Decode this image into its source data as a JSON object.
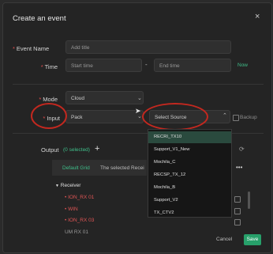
{
  "dialog": {
    "title": "Create an event",
    "close_glyph": "×"
  },
  "form": {
    "event_name": {
      "label": "Event Name",
      "required_mark": "*",
      "placeholder": "Add title"
    },
    "time": {
      "label": "Time",
      "required_mark": "*",
      "start_placeholder": "Start time",
      "separator": "-",
      "end_placeholder": "End time",
      "now_label": "Now"
    },
    "mode": {
      "label": "Mode",
      "required_mark": "*",
      "value": "Cloud"
    },
    "input": {
      "label": "Input",
      "required_mark": "*",
      "value": "Pack",
      "source_placeholder": "Select Source",
      "backup_label": "Backup"
    }
  },
  "source_options": [
    "RECRI_TX10",
    "Support_V1_New",
    "Mochila_C",
    "RECSP_TX_12",
    "Mochila_B",
    "Support_V2",
    "TX_CTV2"
  ],
  "output": {
    "label": "Output",
    "selected_count": "(0 selected)",
    "add_glyph": "+",
    "tabs": {
      "default_grid": "Default Grid",
      "info": "The selected Recei"
    },
    "receiver_group": "Receiver",
    "receivers": [
      "ION_RX 01",
      "WIN",
      "ION_RX 03",
      "UM RX 01"
    ]
  },
  "footer": {
    "cancel_label": "Cancel",
    "save_label": "Save"
  },
  "colors": {
    "accent": "#27a06a",
    "required": "#e34d4d",
    "highlight": "#c3281f"
  }
}
